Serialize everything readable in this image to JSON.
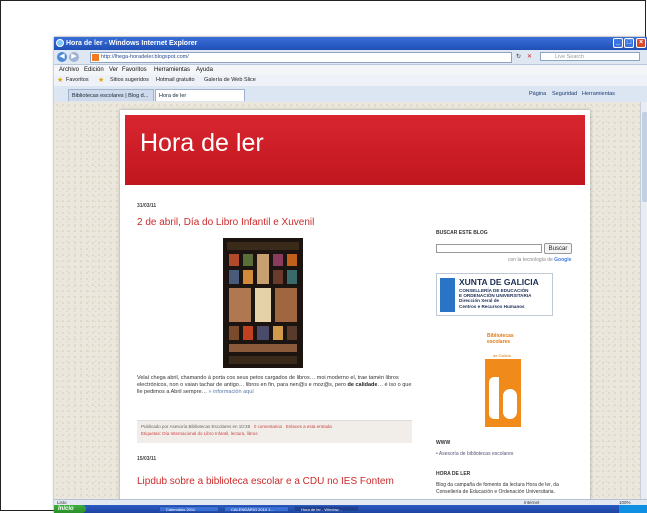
{
  "window": {
    "title": "Hora de ler - Windows Internet Explorer",
    "url": "http://lhega-horadeler.blogspot.com/",
    "search_placeholder": "Live Search"
  },
  "menu": [
    "Archivo",
    "Edición",
    "Ver",
    "Favoritos",
    "Herramientas",
    "Ayuda"
  ],
  "favorites_bar": [
    "Favoritos",
    "Sitios sugeridos",
    "Hotmail gratuito",
    "Galería de Web Slice"
  ],
  "tabs": [
    "Bibliotecas escolares | Blog d...",
    "Hora de ler"
  ],
  "commandbar": [
    "Página",
    "Seguridad",
    "Herramientas"
  ],
  "blog": {
    "title": "Hora de ler",
    "post1": {
      "date": "31/03/11",
      "title": "2 de abril, Día do Libro Infantil e Xuvenil",
      "body_pre": "Velaí chega abril, chamando á porta cos seus petos cargados de libros… moi moderno el, trae tamén libros electrónicos, non o vaian tachar de antigo… libros en fin, para nen@s e moz@s, pero ",
      "body_bold": "de calidade",
      "body_post": "… é iso o que lle pedimos a Abril sempre… ",
      "more": "» información aquí",
      "footer_pre": "Publicado por Asesoría Bibliotecas Escolares en 10:38",
      "footer_comments": "0 comentarios",
      "footer_link": "Enlaces a esta entrada",
      "labels": "Etiquetas: Día Internacional do Libro Infantil, lectura, libros"
    },
    "post2": {
      "date": "15/03/11",
      "title": "Lipdub sobre a biblioteca escolar e a CDU no IES Fontem"
    },
    "sidebar": {
      "search_heading": "BUSCAR ESTE BLOG",
      "search_button": "Buscar",
      "powered_pre": "con la tecnología de ",
      "powered_google": "Google",
      "xunta_name": "XUNTA DE GALICIA",
      "xunta_lines": [
        "CONSELLERÍA DE EDUCACIÓN",
        "E ORDENACIÓN UNIVERSITARIA",
        "Dirección Xeral de",
        "Centros e Recursos Humanos"
      ],
      "bib_title": "Bibliotecas escolares",
      "bib_sub": "de Galicia",
      "www_heading": "WWW",
      "www_link": "Asesoría de bibliotecas escolares",
      "about_heading": "HORA DE LER",
      "about_text": "Blog da campaña de fomento da lectura Hora de ler, da Consellería de Educación e Ordenación Universitaria."
    }
  },
  "status": {
    "left": "Listo",
    "zone": "Internet",
    "zoom": "100%"
  },
  "taskbar": {
    "start": "Inicio",
    "items": [
      "Calendário 2011",
      "CALENDÁRIO 2010 1...",
      "Hora de ler - Window..."
    ]
  }
}
